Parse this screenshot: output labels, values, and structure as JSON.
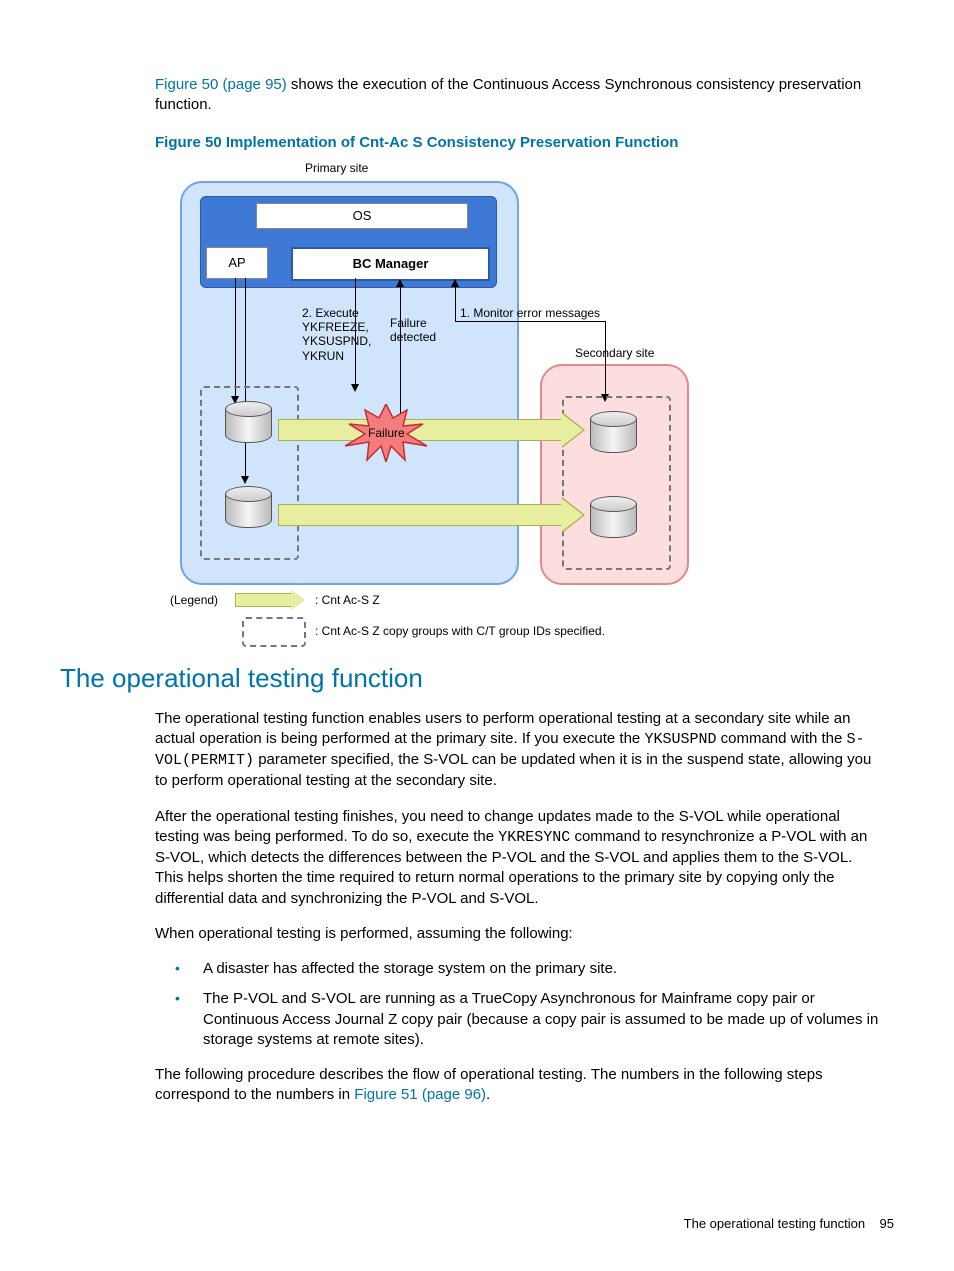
{
  "intro": {
    "link": "Figure 50 (page 95)",
    "rest": " shows the execution of the Continuous Access Synchronous consistency preservation function."
  },
  "figure50": {
    "caption": "Figure 50 Implementation of Cnt-Ac S Consistency Preservation Function",
    "labels": {
      "primary_site": "Primary site",
      "secondary_site": "Secondary site",
      "os": "OS",
      "ap": "AP",
      "bc_manager": "BC Manager",
      "step2": "2. Execute\nYKFREEZE,\nYKSUSPND,\nYKRUN",
      "failure_detected": "Failure\ndetected",
      "step1": "1. Monitor error messages",
      "failure": "Failure",
      "legend_label": "(Legend)",
      "legend_arrow_text": ": Cnt Ac-S Z",
      "legend_dashed_text": ": Cnt Ac-S Z copy groups with C/T group IDs specified."
    }
  },
  "section": {
    "title": "The operational testing function",
    "para1_a": "The operational testing function enables users to perform operational testing at a secondary site while an actual operation is being performed at the primary site. If you execute the ",
    "para1_code1": "YKSUSPND",
    "para1_b": " command with the ",
    "para1_code2": "S-VOL(PERMIT)",
    "para1_c": " parameter specified, the S-VOL can be updated when it is in the suspend state, allowing you to perform operational testing at the secondary site.",
    "para2_a": "After the operational testing finishes, you need to change updates made to the S-VOL while operational testing was being performed. To do so, execute the ",
    "para2_code1": "YKRESYNC",
    "para2_b": " command to resynchronize a P-VOL with an S-VOL, which detects the differences between the P-VOL and the S-VOL and applies them to the S-VOL. This helps shorten the time required to return normal operations to the primary site by copying only the differential data and synchronizing the P-VOL and S-VOL.",
    "para3": "When operational testing is performed, assuming the following:",
    "bullet1": "A disaster has affected the storage system on the primary site.",
    "bullet2": "The P-VOL and S-VOL are running as a TrueCopy Asynchronous for Mainframe copy pair or Continuous Access Journal Z copy pair (because a copy pair is assumed to be made up of volumes in storage systems at remote sites).",
    "para4_a": "The following procedure describes the flow of operational testing. The numbers in the following steps correspond to the numbers in ",
    "para4_link": "Figure 51 (page 96)",
    "para4_b": "."
  },
  "footer": {
    "text": "The operational testing function",
    "page": "95"
  }
}
